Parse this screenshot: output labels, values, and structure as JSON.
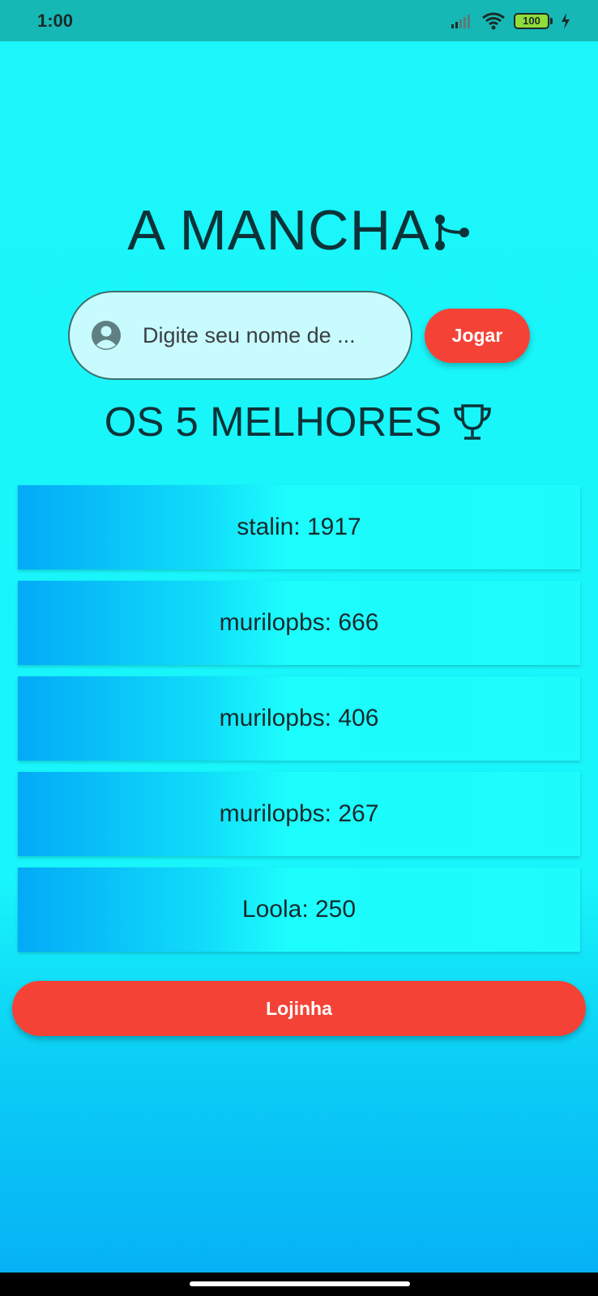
{
  "status_bar": {
    "time": "1:00",
    "battery_level": "100",
    "icons": [
      "signal-icon",
      "wifi-icon",
      "battery-icon",
      "charging-icon"
    ]
  },
  "header": {
    "title": "A MANCHA",
    "title_icon": "graph-nodes-icon"
  },
  "name_input": {
    "placeholder": "Digite seu nome de ...",
    "icon": "account-circle-icon"
  },
  "play_button": {
    "label": "Jogar"
  },
  "leaderboard": {
    "title": "OS 5 MELHORES",
    "title_icon": "trophy-icon",
    "entries": [
      {
        "label": "stalin: 1917"
      },
      {
        "label": "murilopbs: 666"
      },
      {
        "label": "murilopbs: 406"
      },
      {
        "label": "murilopbs: 267"
      },
      {
        "label": "Loola: 250"
      }
    ]
  },
  "shop_button": {
    "label": "Lojinha"
  },
  "colors": {
    "status_bar": "#16b8b5",
    "background_top": "#1af6fa",
    "background_bottom": "#06b2f5",
    "accent_button": "#f44336",
    "text_dark": "#0d3338"
  }
}
